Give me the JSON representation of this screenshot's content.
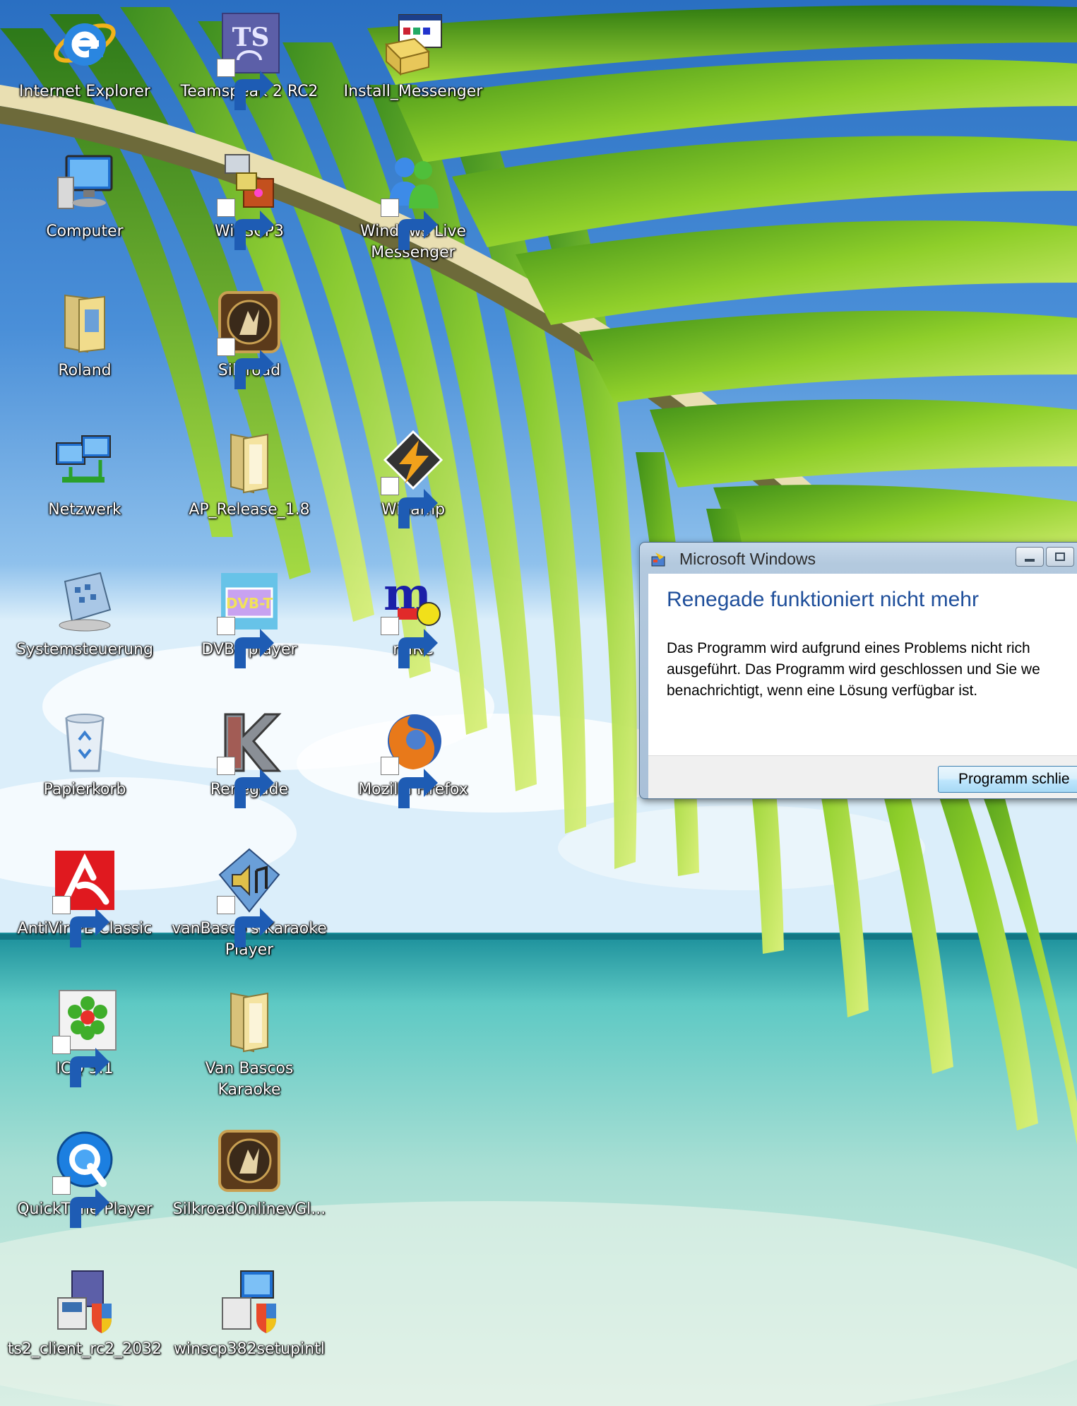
{
  "desktop": {
    "icons": [
      {
        "label": "Internet Explorer",
        "icon": "internet-explorer-icon",
        "shortcut": false
      },
      {
        "label": "Teamspeak 2 RC2",
        "icon": "teamspeak-icon",
        "shortcut": true
      },
      {
        "label": "Install_Messenger",
        "icon": "installer-icon",
        "shortcut": false
      },
      {
        "label": "Computer",
        "icon": "computer-icon",
        "shortcut": false
      },
      {
        "label": "WinSCP3",
        "icon": "winscp-icon",
        "shortcut": true
      },
      {
        "label": "Windows Live Messenger",
        "icon": "messenger-icon",
        "shortcut": true
      },
      {
        "label": "Roland",
        "icon": "user-folder-icon",
        "shortcut": false
      },
      {
        "label": "Silkroad",
        "icon": "silkroad-icon",
        "shortcut": true
      },
      {
        "label": "Netzwerk",
        "icon": "network-icon",
        "shortcut": false
      },
      {
        "label": "AP_Release_1.8",
        "icon": "folder-icon",
        "shortcut": false
      },
      {
        "label": "Winamp",
        "icon": "winamp-icon",
        "shortcut": true
      },
      {
        "label": "Systemsteuerung",
        "icon": "control-panel-icon",
        "shortcut": false
      },
      {
        "label": "DVB-Tplayer",
        "icon": "dvb-player-icon",
        "shortcut": true
      },
      {
        "label": "mIRC",
        "icon": "mirc-icon",
        "shortcut": true
      },
      {
        "label": "Papierkorb",
        "icon": "recycle-bin-icon",
        "shortcut": false
      },
      {
        "label": "Renegade",
        "icon": "renegade-icon",
        "shortcut": true
      },
      {
        "label": "Mozilla Firefox",
        "icon": "firefox-icon",
        "shortcut": true
      },
      {
        "label": "AntiVir PE Classic",
        "icon": "antivir-icon",
        "shortcut": true
      },
      {
        "label": "vanBasco's Karaoke Player",
        "icon": "karaoke-player-icon",
        "shortcut": true
      },
      {
        "label": "ICQ 5.1",
        "icon": "icq-icon",
        "shortcut": true
      },
      {
        "label": "Van Bascos Karaoke",
        "icon": "folder-icon",
        "shortcut": false
      },
      {
        "label": "QuickTime Player",
        "icon": "quicktime-icon",
        "shortcut": true
      },
      {
        "label": "SilkroadOnlinevGl...",
        "icon": "silkroad-icon",
        "shortcut": false
      },
      {
        "label": "ts2_client_rc2_2032",
        "icon": "setup-installer-icon",
        "shortcut": false
      },
      {
        "label": "winscp382setupintl",
        "icon": "setup-installer-icon",
        "shortcut": false
      }
    ]
  },
  "dialog": {
    "title": "Microsoft Windows",
    "heading": "Renegade funktioniert nicht mehr",
    "body_lines": [
      "Das Programm wird aufgrund eines Problems nicht rich",
      "ausgeführt. Das Programm wird geschlossen und Sie we",
      "benachrichtigt, wenn eine Lösung verfügbar ist."
    ],
    "button_label": "Programm schlie"
  }
}
